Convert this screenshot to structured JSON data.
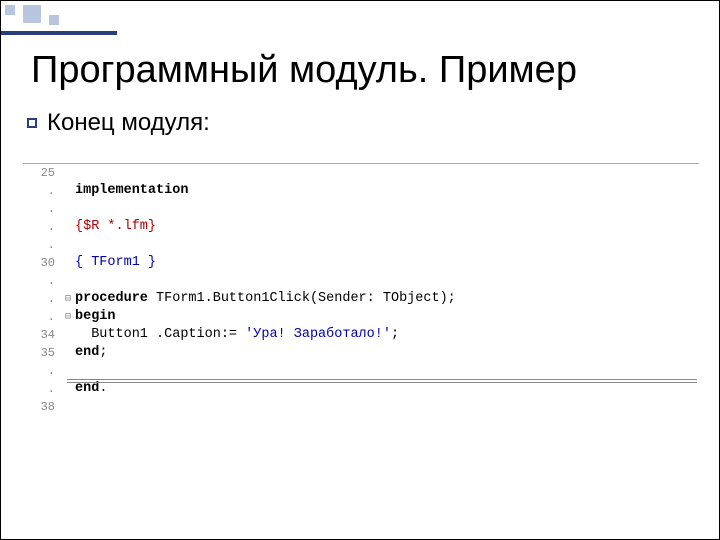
{
  "slide": {
    "title": "Программный модуль. Пример",
    "subtitle": "Конец модуля:"
  },
  "code": {
    "lines": [
      {
        "num": "25",
        "fold": "",
        "text": ""
      },
      {
        "num": ".",
        "fold": "",
        "kw": "implementation"
      },
      {
        "num": ".",
        "fold": "",
        "text": ""
      },
      {
        "num": ".",
        "fold": "",
        "dir": "{$R *.lfm}"
      },
      {
        "num": ".",
        "fold": "",
        "text": ""
      },
      {
        "num": "30",
        "fold": "",
        "cmt": "{ TForm1 }"
      },
      {
        "num": ".",
        "fold": "",
        "text": ""
      },
      {
        "num": ".",
        "fold": "⊟",
        "proc_kw": "procedure",
        "proc_rest": " TForm1.Button1Click(Sender: TObject);"
      },
      {
        "num": ".",
        "fold": "⊟",
        "kw": "begin"
      },
      {
        "num": "34",
        "fold": "",
        "assign_pre": "  Button1 .Caption:= ",
        "assign_str": "'Ура! Заработало!'",
        "assign_post": ";"
      },
      {
        "num": "35",
        "fold": "",
        "end_kw": "end",
        "end_post": ";"
      },
      {
        "num": ".",
        "fold": "",
        "text": ""
      },
      {
        "num": ".",
        "fold": "",
        "end_kw": "end",
        "end_post": "."
      },
      {
        "num": "38",
        "fold": "",
        "text": ""
      }
    ]
  }
}
